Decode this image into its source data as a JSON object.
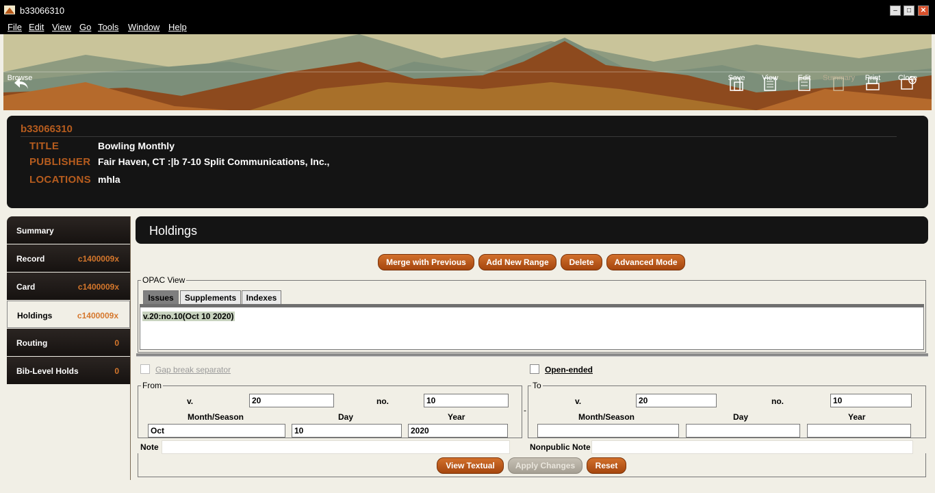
{
  "window": {
    "title": "b33066310"
  },
  "menu": [
    "File",
    "Edit",
    "View",
    "Go",
    "Tools",
    "Window",
    "Help"
  ],
  "toolbar": {
    "browse": "Browse",
    "save": "Save",
    "view": "View",
    "edit": "Edit",
    "summary": "Summary",
    "print": "Print",
    "close": "Close"
  },
  "record": {
    "number": "b33066310",
    "title_label": "TITLE",
    "title": "Bowling Monthly",
    "publisher_label": "PUBLISHER",
    "publisher": "Fair Haven, CT :|b 7-10 Split Communications, Inc.,",
    "locations_label": "LOCATIONS",
    "locations": "mhla"
  },
  "sidebar": [
    {
      "label": "Summary",
      "value": ""
    },
    {
      "label": "Record",
      "value": "c1400009x"
    },
    {
      "label": "Card",
      "value": "c1400009x"
    },
    {
      "label": "Holdings",
      "value": "c1400009x"
    },
    {
      "label": "Routing",
      "value": "0"
    },
    {
      "label": "Bib-Level Holds",
      "value": "0"
    }
  ],
  "content": {
    "title": "Holdings",
    "buttons": {
      "merge": "Merge with Previous",
      "add_range": "Add New Range",
      "delete": "Delete",
      "advanced": "Advanced Mode"
    },
    "opac_legend": "OPAC View",
    "tabs": [
      "Issues",
      "Supplements",
      "Indexes"
    ],
    "issue_line": "v.20:no.10(Oct  10  2020)",
    "gap_break": "Gap break separator",
    "open_ended": "Open-ended",
    "from": {
      "legend": "From",
      "v_label": "v.",
      "v_value": "20",
      "no_label": "no.",
      "no_value": "10",
      "month_label": "Month/Season",
      "day_label": "Day",
      "year_label": "Year",
      "month_value": "Oct",
      "day_value": "10",
      "year_value": "2020"
    },
    "to": {
      "legend": "To",
      "v_label": "v.",
      "v_value": "20",
      "no_label": "no.",
      "no_value": "10",
      "month_label": "Month/Season",
      "day_label": "Day",
      "year_label": "Year",
      "month_value": "",
      "day_value": "",
      "year_value": ""
    },
    "range_dash": "-",
    "note_label": "Note",
    "note_value": "",
    "nonpublic_label": "Nonpublic Note",
    "nonpublic_value": "",
    "bottom_buttons": {
      "view_textual": "View Textual",
      "apply": "Apply Changes",
      "reset": "Reset"
    }
  }
}
